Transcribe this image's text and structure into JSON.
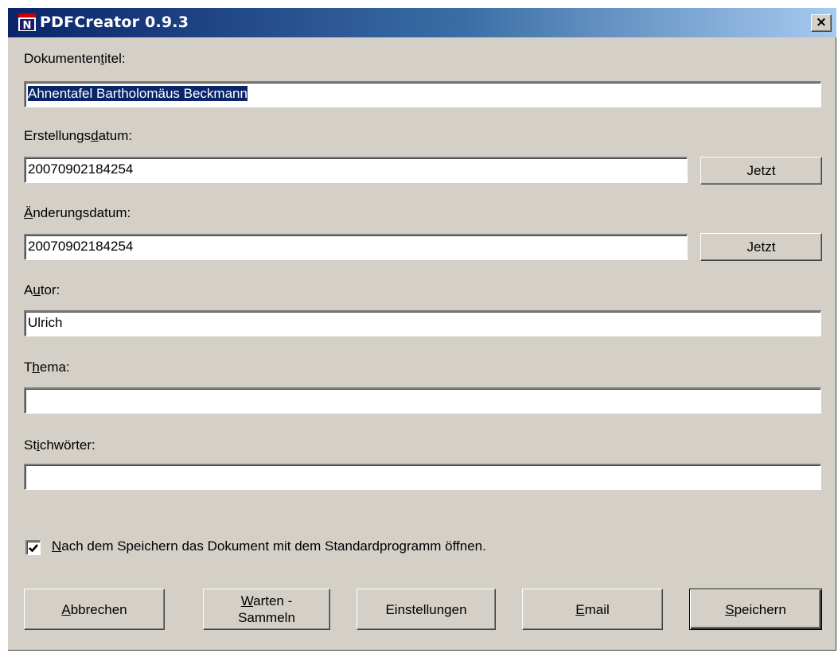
{
  "window": {
    "title": "PDFCreator 0.9.3",
    "close_glyph": "×"
  },
  "fields": {
    "title": {
      "label_pre": "Dokumenten",
      "label_key": "t",
      "label_post": "itel:",
      "value": "Ahnentafel Bartholomäus Beckmann"
    },
    "created": {
      "label_pre": "Erstellungs",
      "label_key": "d",
      "label_post": "atum:",
      "value": "20070902184254"
    },
    "modified": {
      "label_pre": "",
      "label_key": "Ä",
      "label_post": "nderungsdatum:",
      "value": "20070902184254"
    },
    "author": {
      "label_pre": "A",
      "label_key": "u",
      "label_post": "tor:",
      "value": "Ulrich"
    },
    "subject": {
      "label_pre": "T",
      "label_key": "h",
      "label_post": "ema:",
      "value": ""
    },
    "keywords": {
      "label_pre": "St",
      "label_key": "i",
      "label_post": "chwörter:",
      "value": ""
    }
  },
  "now_button_label": "Jetzt",
  "open_after_save": {
    "checked": true,
    "label_key": "N",
    "label_rest": "ach dem Speichern das Dokument mit dem Standardprogramm öffnen."
  },
  "buttons": {
    "cancel": {
      "key": "A",
      "rest": "bbrechen"
    },
    "wait_line1_key": "W",
    "wait_line1_rest": "arten -",
    "wait_line2": "Sammeln",
    "settings": "Einstellungen",
    "email": {
      "key": "E",
      "rest": "mail"
    },
    "save": {
      "key": "S",
      "rest": "peichern"
    }
  },
  "icons": {
    "app": "pdfcreator-app-icon",
    "check": "checkmark-icon"
  }
}
